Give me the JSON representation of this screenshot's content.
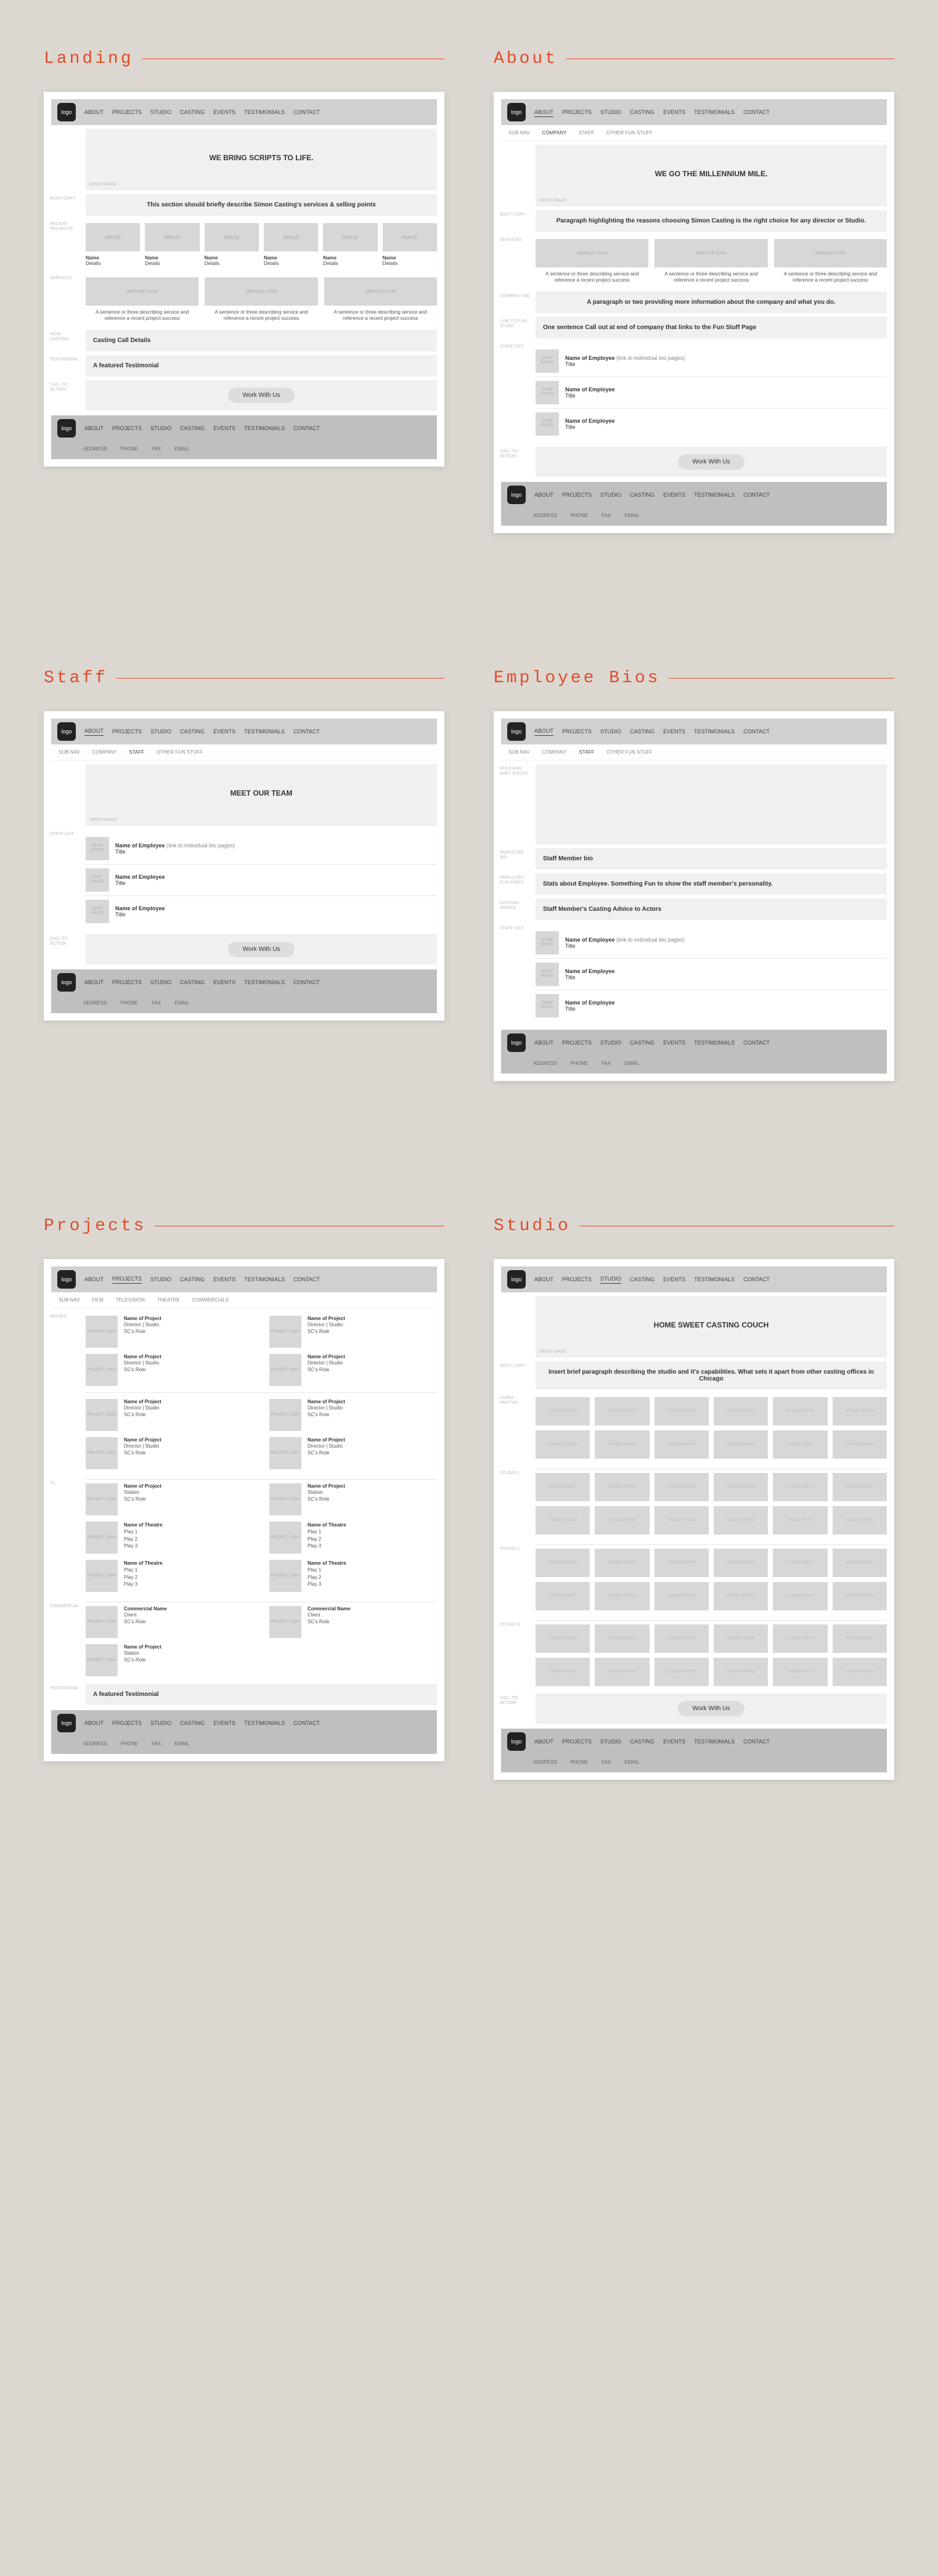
{
  "nav": {
    "logo": "logo",
    "items": [
      "ABOUT",
      "PROJECTS",
      "STUDIO",
      "CASTING",
      "EVENTS",
      "TESTIMONIALS",
      "CONTACT"
    ]
  },
  "subnav_about": [
    "SUB NAV",
    "COMPANY",
    "STAFF",
    "OTHER FUN STUFF"
  ],
  "subnav_projects": [
    "SUB NAV",
    "FILM",
    "TELEVISION",
    "THEATRE",
    "COMMERCIALS"
  ],
  "footer_meta": [
    "ADDRESS",
    "PHONE",
    "FAX",
    "EMAIL"
  ],
  "placeholders": {
    "image": "IMAGE",
    "service_icon": "SERVICE ICON",
    "staff_photo": "STAFF PHOTO",
    "project_logo": "PROJECT LOGO",
    "studio_photo": "STUDIO PHOTO",
    "hero_image": "HERO IMAGE",
    "name": "Name",
    "details": "Details"
  },
  "common": {
    "cta_button": "Work With Us",
    "svc_text": "A sentence or three describing service and reference a recent project success"
  },
  "side_labels": {
    "body_copy": "BODY COPY",
    "recent_projects": "RECENT PROJECTS",
    "services": "SERVICES",
    "now_casting": "NOW CASTING",
    "testimonial": "TESTIMONIAL",
    "call_to_action": "CALL TO ACTION",
    "company_bio": "COMPANY BIO",
    "link_to_fun_stuff": "LINK TO FUN STUFF",
    "staff_list": "STAFF LIST",
    "role_and_baby_photo": "ROLE AND BABY PHOTO",
    "employee_bio": "EMPLOYEE BIO",
    "employee_fun_stats": "EMPLOYEE FUN STATS",
    "casting_advice": "CASTING ADVICE",
    "movies": "MOVIES",
    "tv": "TV",
    "commercial": "COMMERCIAL",
    "lobby_photos": "LOBBY PHOTOS",
    "studio1": "STUDIO 1",
    "studio2": "STUDIO 2",
    "studio3": "STUDIO 3"
  },
  "pages": {
    "landing": {
      "label": "Landing",
      "hero_title": "WE BRING SCRIPTS TO LIFE.",
      "body_copy": "This section should briefly describe Simon Casting's services & selling points",
      "now_casting": "Casting Call Details",
      "testimonial": "A featured Testimonial"
    },
    "about": {
      "label": "About",
      "hero_title": "WE GO THE MILLENNIUM MILE.",
      "body_copy": "Paragraph highlighting the reasons choosing Simon Casting is the right choice for any director or Studio.",
      "company_bio": "A paragraph or two providing more information about the company and what you do.",
      "fun_link": "One sentence Call out  at end of company that links to the Fun Stuff Page",
      "staff": [
        {
          "name": "Name of Employee",
          "link": "(link to individual bio pages)",
          "title": "Title"
        },
        {
          "name": "Name of Employee",
          "link": "",
          "title": "Title"
        },
        {
          "name": "Name of Employee",
          "link": "",
          "title": "Title"
        }
      ]
    },
    "staff": {
      "label": "Staff",
      "hero_title": "MEET OUR TEAM",
      "staff": [
        {
          "name": "Name of Employee",
          "link": "(link to individual bio pages)",
          "title": "Title"
        },
        {
          "name": "Name of Employee",
          "link": "",
          "title": "Title"
        },
        {
          "name": "Name of Employee",
          "link": "",
          "title": "Title"
        }
      ]
    },
    "bios": {
      "label": "Employee Bios",
      "bio": "Staff Member bio",
      "fun_stats": "Stats about Employee. Something Fun to show the staff member's personality.",
      "advice": "Staff Member's Casting Advice to Actors",
      "staff": [
        {
          "name": "Name of Employee",
          "link": "(link to individual bio pages)",
          "title": "Title"
        },
        {
          "name": "Name of Employee",
          "link": "",
          "title": "Title"
        },
        {
          "name": "Name of Employee",
          "link": "",
          "title": "Title"
        }
      ]
    },
    "projects": {
      "label": "Projects",
      "movie": {
        "n": "Name of Project",
        "d": "Director | Studio",
        "r": "SC's Role"
      },
      "tv": {
        "n": "Name of Project",
        "d": "Station",
        "r": "SC's Role"
      },
      "theatre": {
        "n": "Name of Theatre",
        "p": "Play 1",
        "p2": "Play 2",
        "p3": "Play 3"
      },
      "commercial": {
        "n": "Commercial Name",
        "d": "Client",
        "r": "SC's Role"
      },
      "testimonial": "A featured Testimonial"
    },
    "studio": {
      "label": "Studio",
      "hero_title": "HOME SWEET CASTING COUCH",
      "body_copy": "Insert brief paragraph describing the studio and it's capabilities. What sets it apart from other casting offices in Chicago"
    }
  }
}
